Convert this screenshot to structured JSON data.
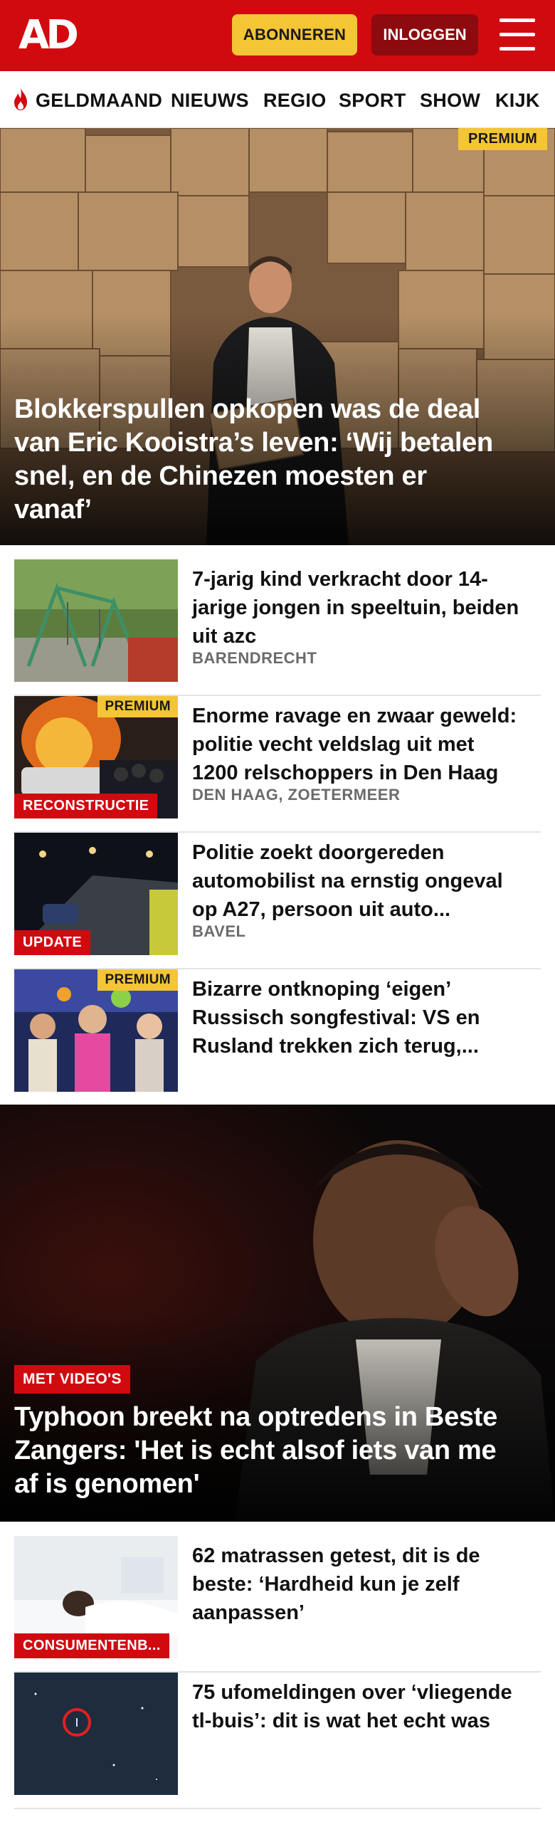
{
  "header": {
    "logo": "AD",
    "subscribe_label": "ABONNEREN",
    "login_label": "INLOGGEN"
  },
  "nav": {
    "items": [
      "GELDMAAND",
      "NIEUWS",
      "REGIO",
      "SPORT",
      "SHOW",
      "KIJK"
    ]
  },
  "hero1": {
    "tag": "PREMIUM",
    "title_lines": [
      "Blokkerspullen opkopen was de deal",
      "van Eric Kooistra’s leven: ‘Wij betalen",
      "snel, en de Chinezen moesten er",
      "vanaf’"
    ]
  },
  "articles": [
    {
      "title_lines": [
        "7-jarig kind verkracht door 14-",
        "jarige jongen in speeltuin, beiden",
        "uit azc"
      ],
      "location": "BARENDRECHT",
      "label": "",
      "premium": ""
    },
    {
      "title_lines": [
        "Enorme ravage en zwaar geweld:",
        "politie vecht veldslag uit met",
        "1200 relschoppers in Den Haag"
      ],
      "location": "DEN HAAG, ZOETERMEER",
      "label": "RECONSTRUCTIE",
      "premium": "PREMIUM"
    },
    {
      "title_lines": [
        "Politie zoekt doorgereden",
        "automobilist na ernstig ongeval",
        "op A27, persoon uit auto..."
      ],
      "location": "BAVEL",
      "label": "UPDATE",
      "premium": ""
    },
    {
      "title_lines": [
        "Bizarre ontknoping ‘eigen’",
        "Russisch songfestival: VS en",
        "Rusland trekken zich terug,..."
      ],
      "location": "",
      "label": "",
      "premium": "PREMIUM"
    }
  ],
  "hero2": {
    "tag": "MET VIDEO'S",
    "title_lines": [
      "Typhoon breekt na optredens in Beste",
      "Zangers: 'Het is echt alsof iets van me",
      "af is genomen'"
    ]
  },
  "articles2": [
    {
      "title_lines": [
        "62 matrassen getest, dit is de",
        "beste: ‘Hardheid kun je zelf",
        "aanpassen’"
      ],
      "label": "CONSUMENTENB..."
    },
    {
      "title_lines": [
        "75 ufomeldingen over ‘vliegende",
        "tl-buis’: dit is wat het echt was"
      ],
      "label": ""
    }
  ],
  "colors": {
    "brand_red": "#d10a10",
    "premium_yellow": "#f4c534",
    "login_dark_red": "#8d0a0f"
  }
}
